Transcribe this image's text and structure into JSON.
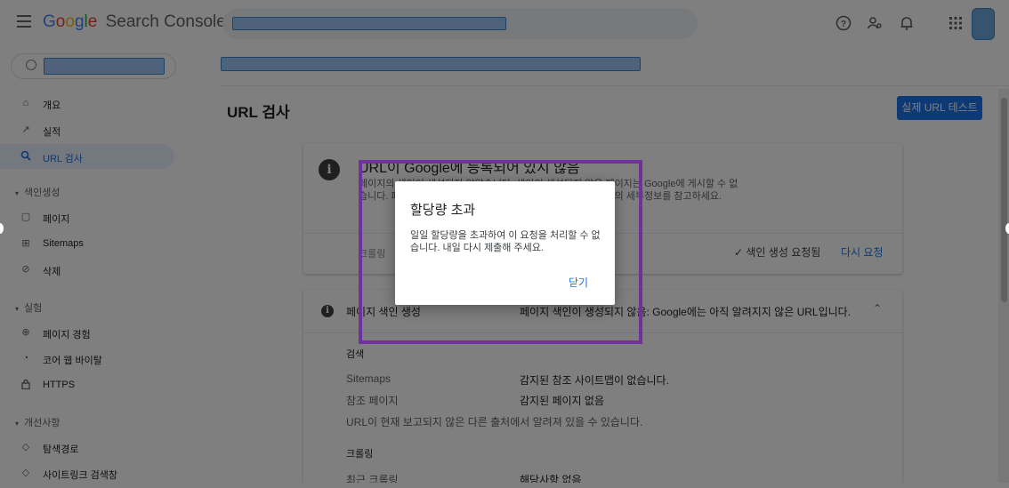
{
  "header": {
    "logo_letters": [
      "G",
      "o",
      "o",
      "g",
      "l",
      "e"
    ],
    "product_name": "Search Console",
    "icons": [
      "help-icon",
      "manage-users-icon",
      "notifications-icon",
      "apps-icon"
    ]
  },
  "page": {
    "title": "URL 검사",
    "live_test_button": "실제 URL 테스트"
  },
  "sidebar": {
    "items": [
      {
        "label": "개요",
        "icon": "home-icon"
      },
      {
        "label": "실적",
        "icon": "trending-icon"
      },
      {
        "label": "URL 검사",
        "icon": "search-icon",
        "active": true
      },
      {
        "label": "페이지",
        "icon": "pages-icon"
      },
      {
        "label": "Sitemaps",
        "icon": "sitemaps-icon"
      },
      {
        "label": "삭제",
        "icon": "removals-icon"
      },
      {
        "label": "페이지 경험",
        "icon": "page-experience-icon"
      },
      {
        "label": "코어 웹 바이탈",
        "icon": "gauge-icon"
      },
      {
        "label": "HTTPS",
        "icon": "lock-icon"
      },
      {
        "label": "탐색경로",
        "icon": "breadcrumbs-icon"
      },
      {
        "label": "사이트링크 검색창",
        "icon": "sitelinks-icon"
      }
    ],
    "sections": [
      "색인생성",
      "실험",
      "개선사항"
    ]
  },
  "status_card": {
    "heading": "URL이 Google에 등록되어 있지 않음",
    "description": "페이지의 색인이 생성되지 않았습니다. 색인이 생성되지 않은 페이지는 Google에 게시할 수 없습니다. 페이지의 색인이 생성되지 않은 이유를 확인하려면 아래의 세부정보를 참고하세요.",
    "crawl_note": "크롤링",
    "indexing_requested": "✓ 색인 생성 요청됨",
    "request_again": "다시 요청"
  },
  "coverage_card": {
    "title": "페이지 색인 생성",
    "status": "페이지 색인이 생성되지 않음: Google에는 아직 알려지지 않은 URL입니다.",
    "discovery_heading": "검색",
    "sitemaps_label": "Sitemaps",
    "sitemaps_value": "감지된 참조 사이트맵이 없습니다.",
    "referring_label": "참조 페이지",
    "referring_value": "감지된 페이지 없음",
    "note": "URL이 현재 보고되지 않은 다른 출처에서 알려져 있을 수 있습니다.",
    "crawl_heading": "크롤링",
    "last_crawl_label": "최근 크롤링",
    "last_crawl_value": "해당사항 없음"
  },
  "dialog": {
    "title": "할당량 초과",
    "message": "일일 할당량을 초과하여 이 요청을 처리할 수 없습니다. 내일 다시 제출해 주세요.",
    "close_button": "닫기"
  },
  "colors": {
    "accent": "#1a73e8",
    "highlight": "#7030a0",
    "redaction": "#9fc5f8"
  }
}
